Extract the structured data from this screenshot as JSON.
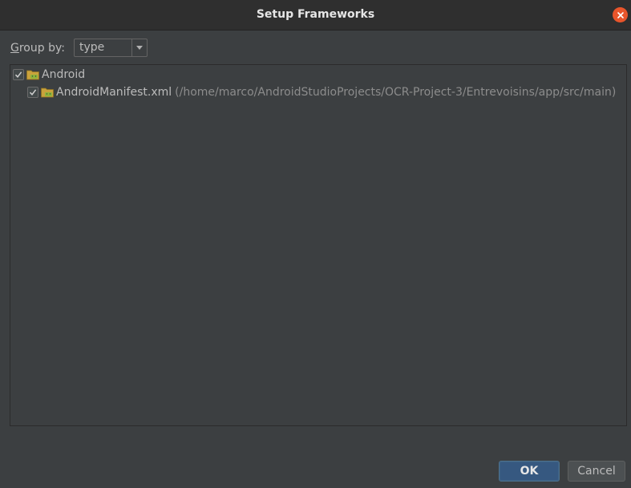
{
  "dialog": {
    "title": "Setup Frameworks"
  },
  "group_by": {
    "label_mnemonic": "G",
    "label_rest": "roup by:",
    "selected": "type"
  },
  "tree": {
    "root": {
      "label": "Android",
      "checked": true,
      "icon": "android-folder-icon"
    },
    "child": {
      "label": "AndroidManifest.xml",
      "path": "(/home/marco/AndroidStudioProjects/OCR-Project-3/Entrevoisins/app/src/main)",
      "checked": true,
      "icon": "android-folder-icon"
    }
  },
  "buttons": {
    "ok": "OK",
    "cancel": "Cancel"
  },
  "colors": {
    "background": "#3c3f41",
    "titlebar": "#2f2f2f",
    "close": "#e9552b",
    "ok_button": "#365880"
  }
}
